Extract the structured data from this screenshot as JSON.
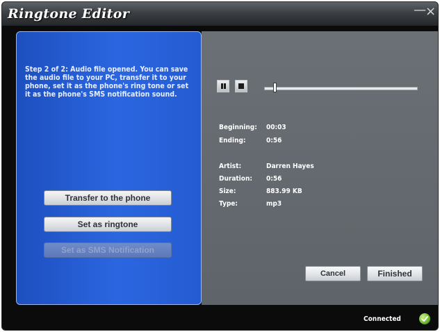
{
  "window": {
    "title": "Ringtone Editor",
    "minimize_glyph": "—",
    "close_glyph": "×"
  },
  "left": {
    "step_text": "Step 2 of 2: Audio file opened. You can save the audio file to your PC, transfer it to your phone, set it as the phone's ring tone or set it as the phone's SMS notification sound.",
    "buttons": {
      "transfer": "Transfer to the phone",
      "ringtone": "Set as ringtone",
      "sms": "Set as SMS Notification"
    }
  },
  "player": {
    "position_fraction": 0.06
  },
  "info": {
    "beginning_label": "Beginning:",
    "beginning_value": "00:03",
    "ending_label": "Ending:",
    "ending_value": "0:56",
    "artist_label": "Artist:",
    "artist_value": "Darren Hayes",
    "duration_label": "Duration:",
    "duration_value": "0:56",
    "size_label": "Size:",
    "size_value": "883.99 KB",
    "type_label": "Type:",
    "type_value": "mp3"
  },
  "actions": {
    "cancel": "Cancel",
    "finished": "Finished"
  },
  "status": {
    "text": "Connected",
    "icon": "check-icon",
    "color": "#6db52b"
  }
}
